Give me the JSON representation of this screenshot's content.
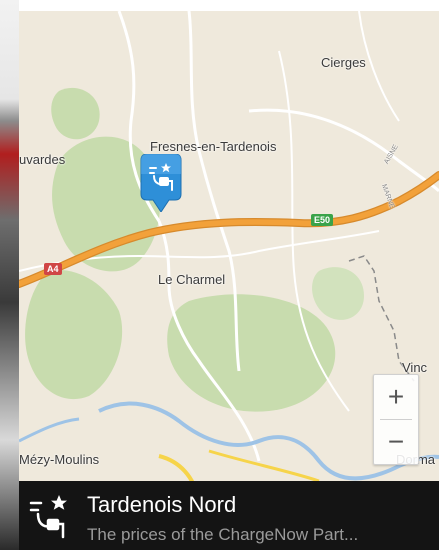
{
  "map": {
    "places": {
      "cierges": "Cierges",
      "fresnes": "Fresnes-en-Tardenois",
      "uvardes": "uvardes",
      "le_charmel": "Le Charmel",
      "vinc": "Vinc",
      "mezy": "Mézy-Moulins",
      "dorma": "Dorma"
    },
    "roads": {
      "e50": "E50",
      "a4": "A4",
      "aisne": "AISNE",
      "marne": "MARNE"
    },
    "marker_icon": "charging-station-icon"
  },
  "zoom": {
    "in_label": "+",
    "out_label": "−"
  },
  "station": {
    "title": "Tardenois Nord",
    "subtitle": "The prices of the ChargeNow Part..."
  },
  "colors": {
    "map_bg": "#efe9dc",
    "forest": "#c8dcae",
    "highway": "#f2a13a",
    "water": "#9ec3e6",
    "marker": "#2e8fd8",
    "bar_bg": "#141414"
  }
}
